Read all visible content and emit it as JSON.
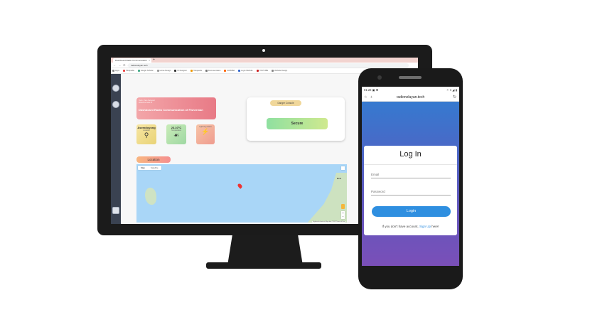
{
  "browser": {
    "tab_title": "Dashboard Radio Communication",
    "tab_close": "×",
    "new_tab": "+",
    "nav_buttons": "← → ⟳ ⌂",
    "url": "radionelayan.tech",
    "bookmarks": [
      "Apps",
      "Tokopedia",
      "Google Scholar",
      "Home Design",
      "UI Designer",
      "Tokopedia",
      "Documentation",
      "ALIBABA",
      "Login Website",
      "YOUTUBE",
      "Website Design"
    ]
  },
  "dashboard": {
    "hero": {
      "small_line1": "Hello, Para Nelayan!",
      "small_line2": "Welcome back to",
      "title": "Dashboard Radio Communication of Fisherman"
    },
    "cards": [
      {
        "value": "Asemdoyong",
        "sub": "Location",
        "glyph": "⚲"
      },
      {
        "value": "23.10°C",
        "sub": "Temperature",
        "glyph": "☙"
      },
      {
        "value": "",
        "sub": "Lightning status",
        "glyph": "⚡"
      }
    ],
    "danger_label": "Danger Console",
    "status": "Secure",
    "location_label": "Location",
    "map": {
      "tab_map": "Map",
      "tab_satellite": "Satellite",
      "place_label": "Brat",
      "zoom_in": "+",
      "zoom_out": "−",
      "attribution": "Keyboard shortcuts   Map data ©2022   Terms of Use"
    }
  },
  "phone": {
    "status_left": "01:22 ▣ ✱",
    "status_right": "⚐ ▾ ◢ ▮",
    "url": "radionelayan.tech",
    "star": "☆",
    "plus": "+",
    "reload": "↻",
    "login": {
      "title": "Log In",
      "email_placeholder": "Email",
      "password_placeholder": "Password",
      "button": "Login",
      "signup_prefix": "If you don't have account,",
      "signup_link": "Sign Up",
      "signup_suffix": "here!"
    }
  },
  "colors": {
    "login_button": "#2f8fe0",
    "phone_gradient_top": "#2f7fd2",
    "phone_gradient_bottom": "#7a4fb8",
    "sidebar": "#3a4251"
  }
}
